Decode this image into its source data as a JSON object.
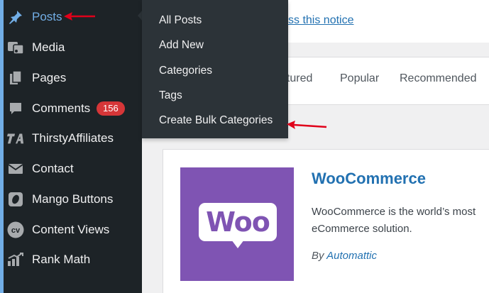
{
  "sidebar": {
    "items": [
      {
        "label": "Posts",
        "icon": "pin-icon"
      },
      {
        "label": "Media",
        "icon": "media-icon"
      },
      {
        "label": "Pages",
        "icon": "pages-icon"
      },
      {
        "label": "Comments",
        "icon": "comments-icon",
        "badge": "156"
      },
      {
        "label": "ThirstyAffiliates",
        "icon": "thirstyaffiliates-icon"
      },
      {
        "label": "Contact",
        "icon": "contact-icon"
      },
      {
        "label": "Mango Buttons",
        "icon": "mango-buttons-icon"
      },
      {
        "label": "Content Views",
        "icon": "content-views-icon"
      },
      {
        "label": "Rank Math",
        "icon": "rank-math-icon"
      }
    ]
  },
  "submenu": {
    "items": [
      {
        "label": "All Posts"
      },
      {
        "label": "Add New"
      },
      {
        "label": "Categories"
      },
      {
        "label": "Tags"
      },
      {
        "label": "Create Bulk Categories"
      }
    ]
  },
  "notice": {
    "link_text": "ss this notice"
  },
  "filter_tabs": [
    {
      "label": "atured"
    },
    {
      "label": "Popular"
    },
    {
      "label": "Recommended"
    }
  ],
  "plugin_card": {
    "name": "WooCommerce",
    "description": "WooCommerce is the world’s most eCommerce solution.",
    "by_prefix": "By ",
    "author": "Automattic",
    "logo_text": "Woo"
  },
  "colors": {
    "sidebar_bg": "#1d2327",
    "submenu_bg": "#2c3338",
    "accent": "#72aee6",
    "badge": "#d63638",
    "link": "#2271b1",
    "woo_purple": "#7f54b3",
    "annotation_arrow": "#e0001a"
  }
}
